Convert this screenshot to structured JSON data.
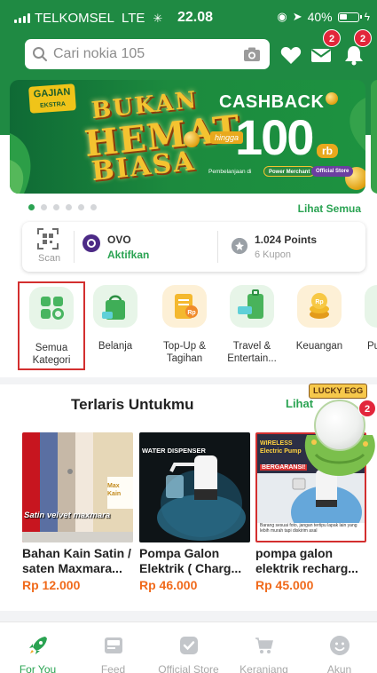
{
  "colors": {
    "brand_green": "#1f8a43",
    "link_green": "#2aa352",
    "price_orange": "#f06a1b",
    "badge_red": "#e2263b"
  },
  "status_bar": {
    "carrier": "TELKOMSEL",
    "network": "LTE",
    "time": "22.08",
    "battery": "40%"
  },
  "header": {
    "search_placeholder": "Cari nokia 105",
    "icons": [
      "search-icon",
      "camera-icon",
      "heart-icon",
      "mail-icon",
      "bell-icon"
    ],
    "mail_badge": "2",
    "notification_badge": "2"
  },
  "banner": {
    "logo_line1": "GAJIAN",
    "logo_line2": "EKSTRA",
    "headline1": "BUKAN",
    "headline2": "HEMAT",
    "headline3": "BIASA",
    "cashback_title": "CASHBACK",
    "cashback_prefix": "hingga",
    "cashback_amount": "100",
    "cashback_unit": "rb",
    "payment_note": "Pembelanjaan di",
    "merchant1": "Power Merchant",
    "merchant2": "Official Store",
    "carousel_total": 6,
    "carousel_active": 0
  },
  "carousel": {
    "see_all": "Lihat Semua"
  },
  "wallet": {
    "scan_label": "Scan",
    "ovo_title": "OVO",
    "ovo_action": "Aktifkan",
    "points_title": "1.024 Points",
    "points_sub": "6 Kupon"
  },
  "categories": [
    {
      "label": "Semua Kategori",
      "icon": "grid-icon",
      "selected": true
    },
    {
      "label": "Belanja",
      "icon": "shopping-bag-icon",
      "selected": false
    },
    {
      "label": "Top-Up & Tagihan",
      "icon": "topup-icon",
      "selected": false
    },
    {
      "label": "Travel & Entertain...",
      "icon": "luggage-icon",
      "selected": false
    },
    {
      "label": "Keuangan",
      "icon": "coins-icon",
      "selected": false
    },
    {
      "label": "Pu",
      "icon": "",
      "selected": false
    }
  ],
  "section": {
    "title": "Terlaris Untukmu",
    "more": "Lihat"
  },
  "lucky_egg": {
    "label": "LUCKY EGG",
    "badge": "2"
  },
  "products": [
    {
      "name": "Bahan Kain Satin / saten Maxmara...",
      "price": "Rp 12.000",
      "image_caption": "Satin velvet maxmara",
      "image_tag": "Max Kain"
    },
    {
      "name": "Pompa Galon Elektrik ( Charg...",
      "price": "Rp 46.000",
      "image_caption": "WATER DISPENSER"
    },
    {
      "name": "pompa galon elektrik recharg...",
      "price": "Rp 45.000",
      "image_caption": "WIRELESS Electric Pump",
      "image_tag": "BERGARANSI!",
      "image_note": "Barang sesuai foto, jangan tertipu lapak lain yang lebih murah tapi diskirim asal"
    }
  ],
  "bottom_nav": [
    {
      "label": "For You",
      "icon": "rocket-icon",
      "active": true
    },
    {
      "label": "Feed",
      "icon": "feed-icon",
      "active": false
    },
    {
      "label": "Official Store",
      "icon": "store-badge-icon",
      "active": false
    },
    {
      "label": "Keranjang",
      "icon": "cart-icon",
      "active": false
    },
    {
      "label": "Akun",
      "icon": "account-icon",
      "active": false
    }
  ]
}
